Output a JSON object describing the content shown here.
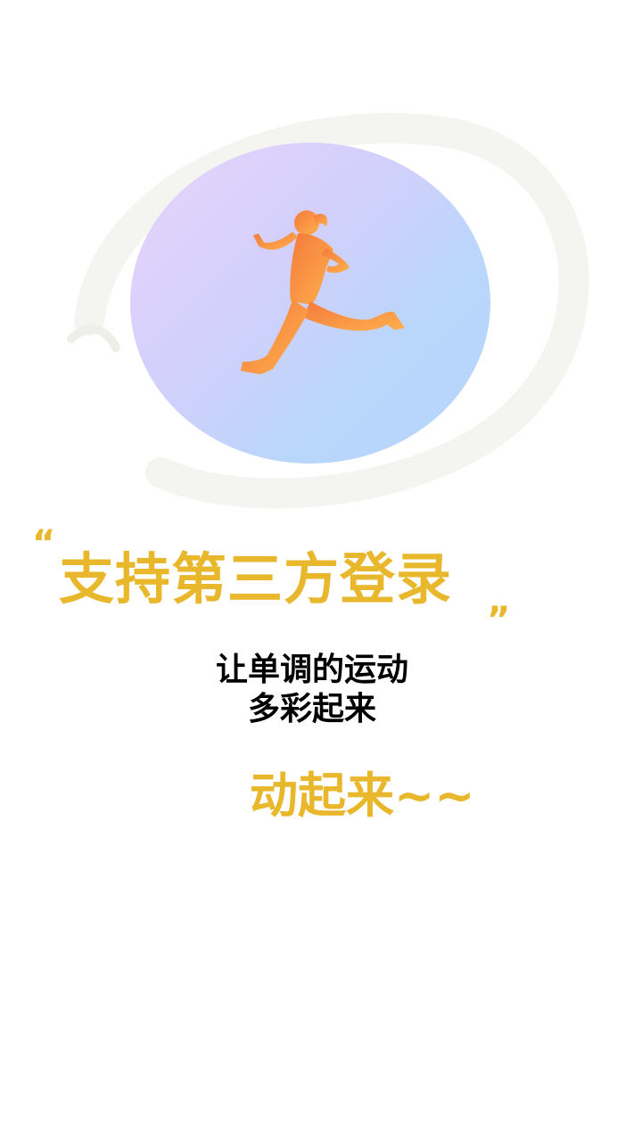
{
  "hero": {
    "icon": "runner-icon",
    "circle_gradient": [
      "#e8d4fb",
      "#b7d7fb"
    ],
    "runner_gradient": [
      "#f47a3b",
      "#ffb04e"
    ]
  },
  "headline": {
    "open_quote": "“",
    "text": "支持第三方登录",
    "close_quote": "”",
    "color": "#e8b72c"
  },
  "subtitle": {
    "line1": "让单调的运动",
    "line2": "多彩起来"
  },
  "cta": {
    "text": "动起来~~",
    "color": "#e8b72c"
  }
}
